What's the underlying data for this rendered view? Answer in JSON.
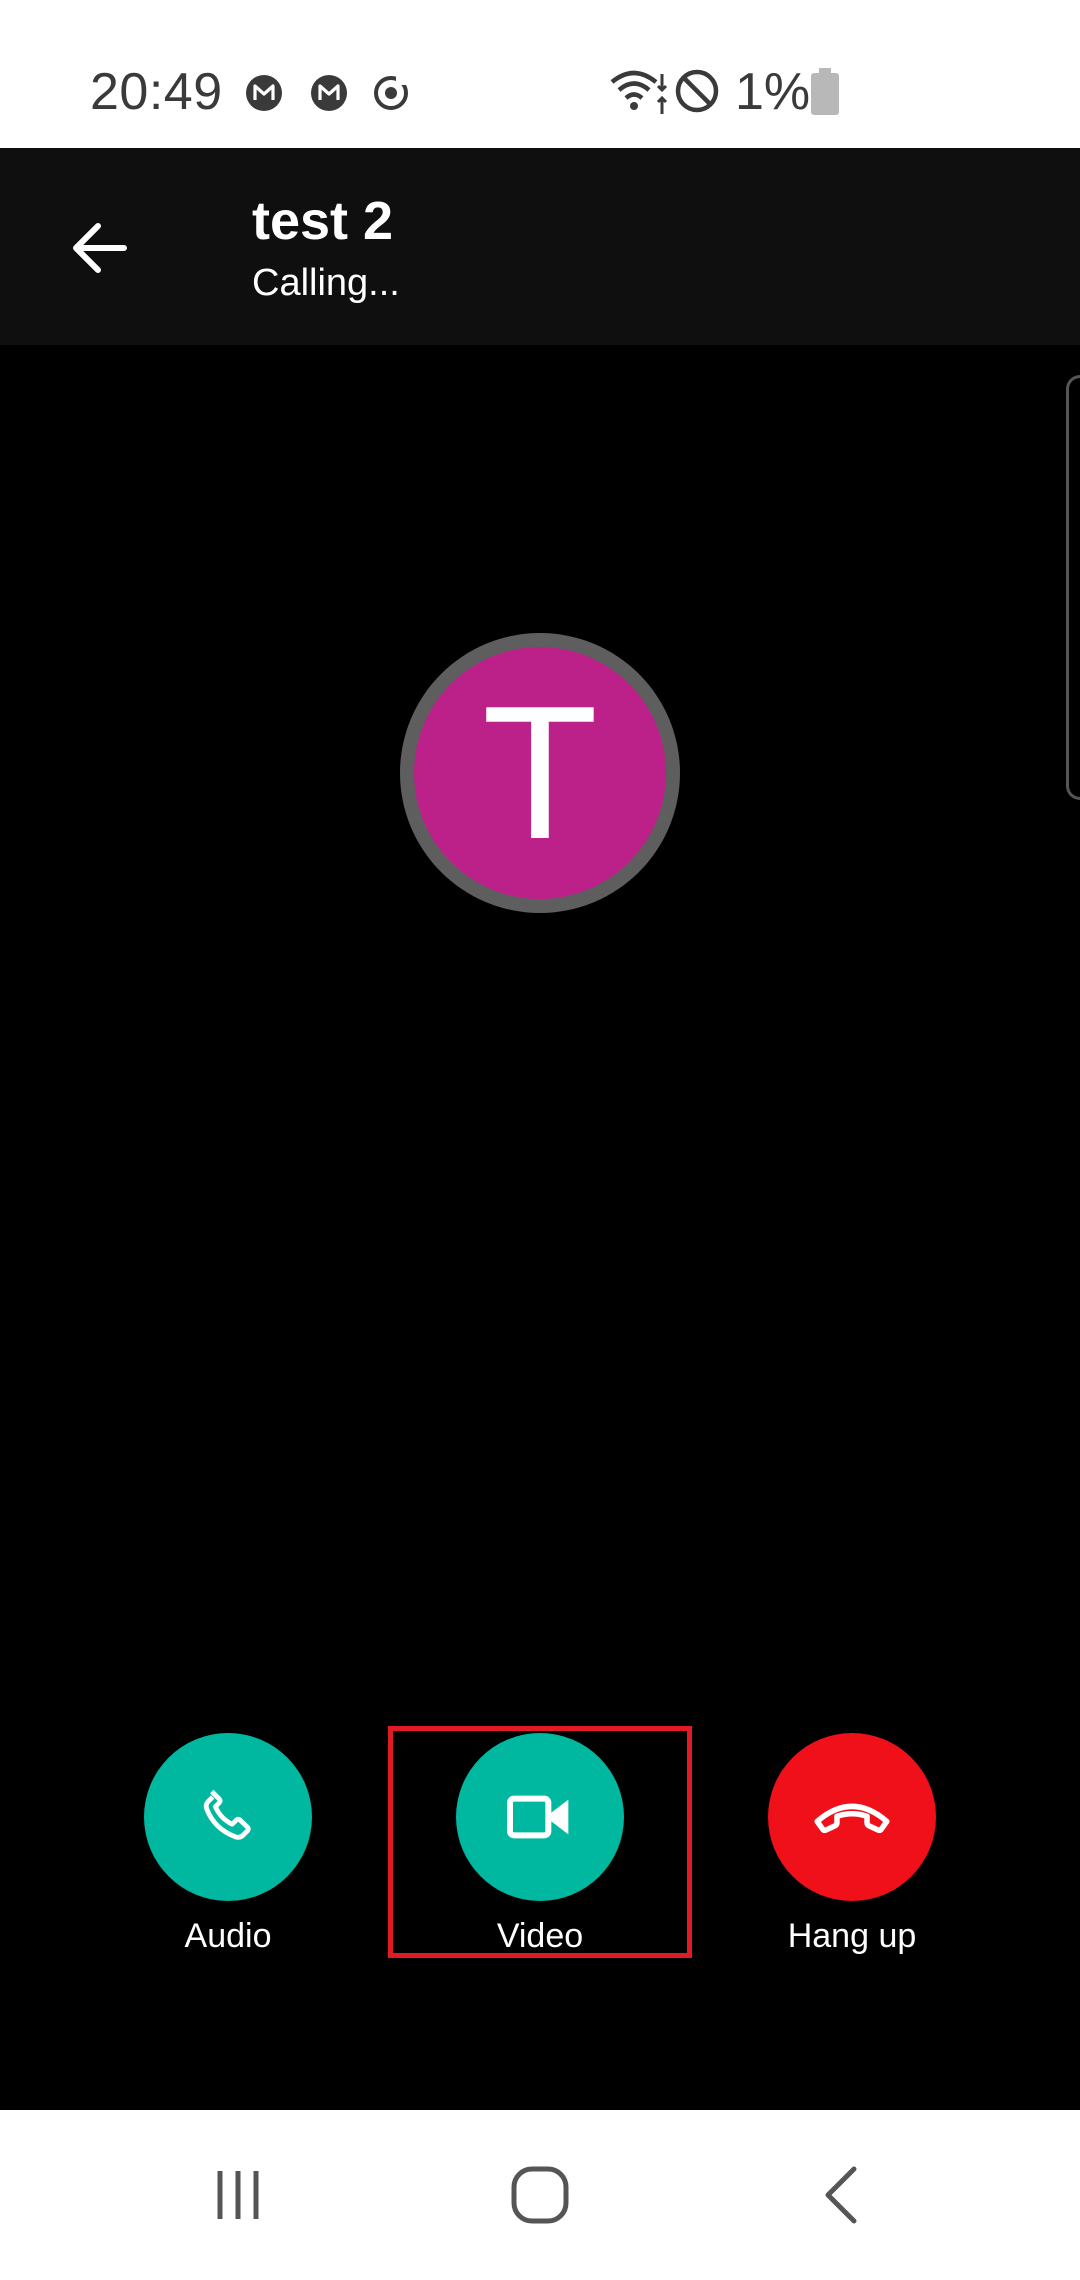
{
  "status_bar": {
    "time": "20:49",
    "notifications": [
      "gmail-icon",
      "gmail-icon",
      "sync-icon"
    ],
    "battery": "1%",
    "indicators": [
      "wifi-icon",
      "do-not-disturb-icon",
      "battery-icon"
    ]
  },
  "header": {
    "contact_name": "test 2",
    "status": "Calling..."
  },
  "avatar": {
    "initial": "T",
    "color": "#bb2188"
  },
  "actions": {
    "audio_label": "Audio",
    "video_label": "Video",
    "hangup_label": "Hang up"
  },
  "colors": {
    "accept": "#00b8a0",
    "hangup": "#f0101a",
    "highlight": "#e01b24"
  }
}
